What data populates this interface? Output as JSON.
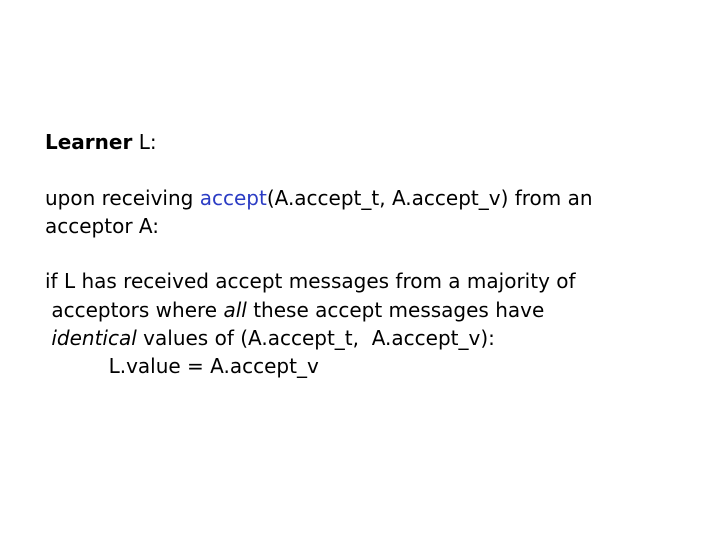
{
  "slide": {
    "heading": {
      "bold": "Learner",
      "rest": " L:"
    },
    "upon": {
      "pre": "upon receiving ",
      "keyword": "accept",
      "post": "(A.accept_t, A.accept_v) from an",
      "line2": "acceptor A:"
    },
    "condition": {
      "line1": "if L has received accept messages from a majority of",
      "line2_pre": " acceptors where ",
      "line2_ital": "all",
      "line2_post": " these accept messages have",
      "line3_lead": " ",
      "line3_ital": "identical",
      "line3_post": " values of (A.accept_t,  A.accept_v):"
    },
    "assignment": "          L.value = A.accept_v",
    "colors": {
      "keyword": "#2b3cc4",
      "text": "#000000",
      "background": "#ffffff"
    }
  }
}
